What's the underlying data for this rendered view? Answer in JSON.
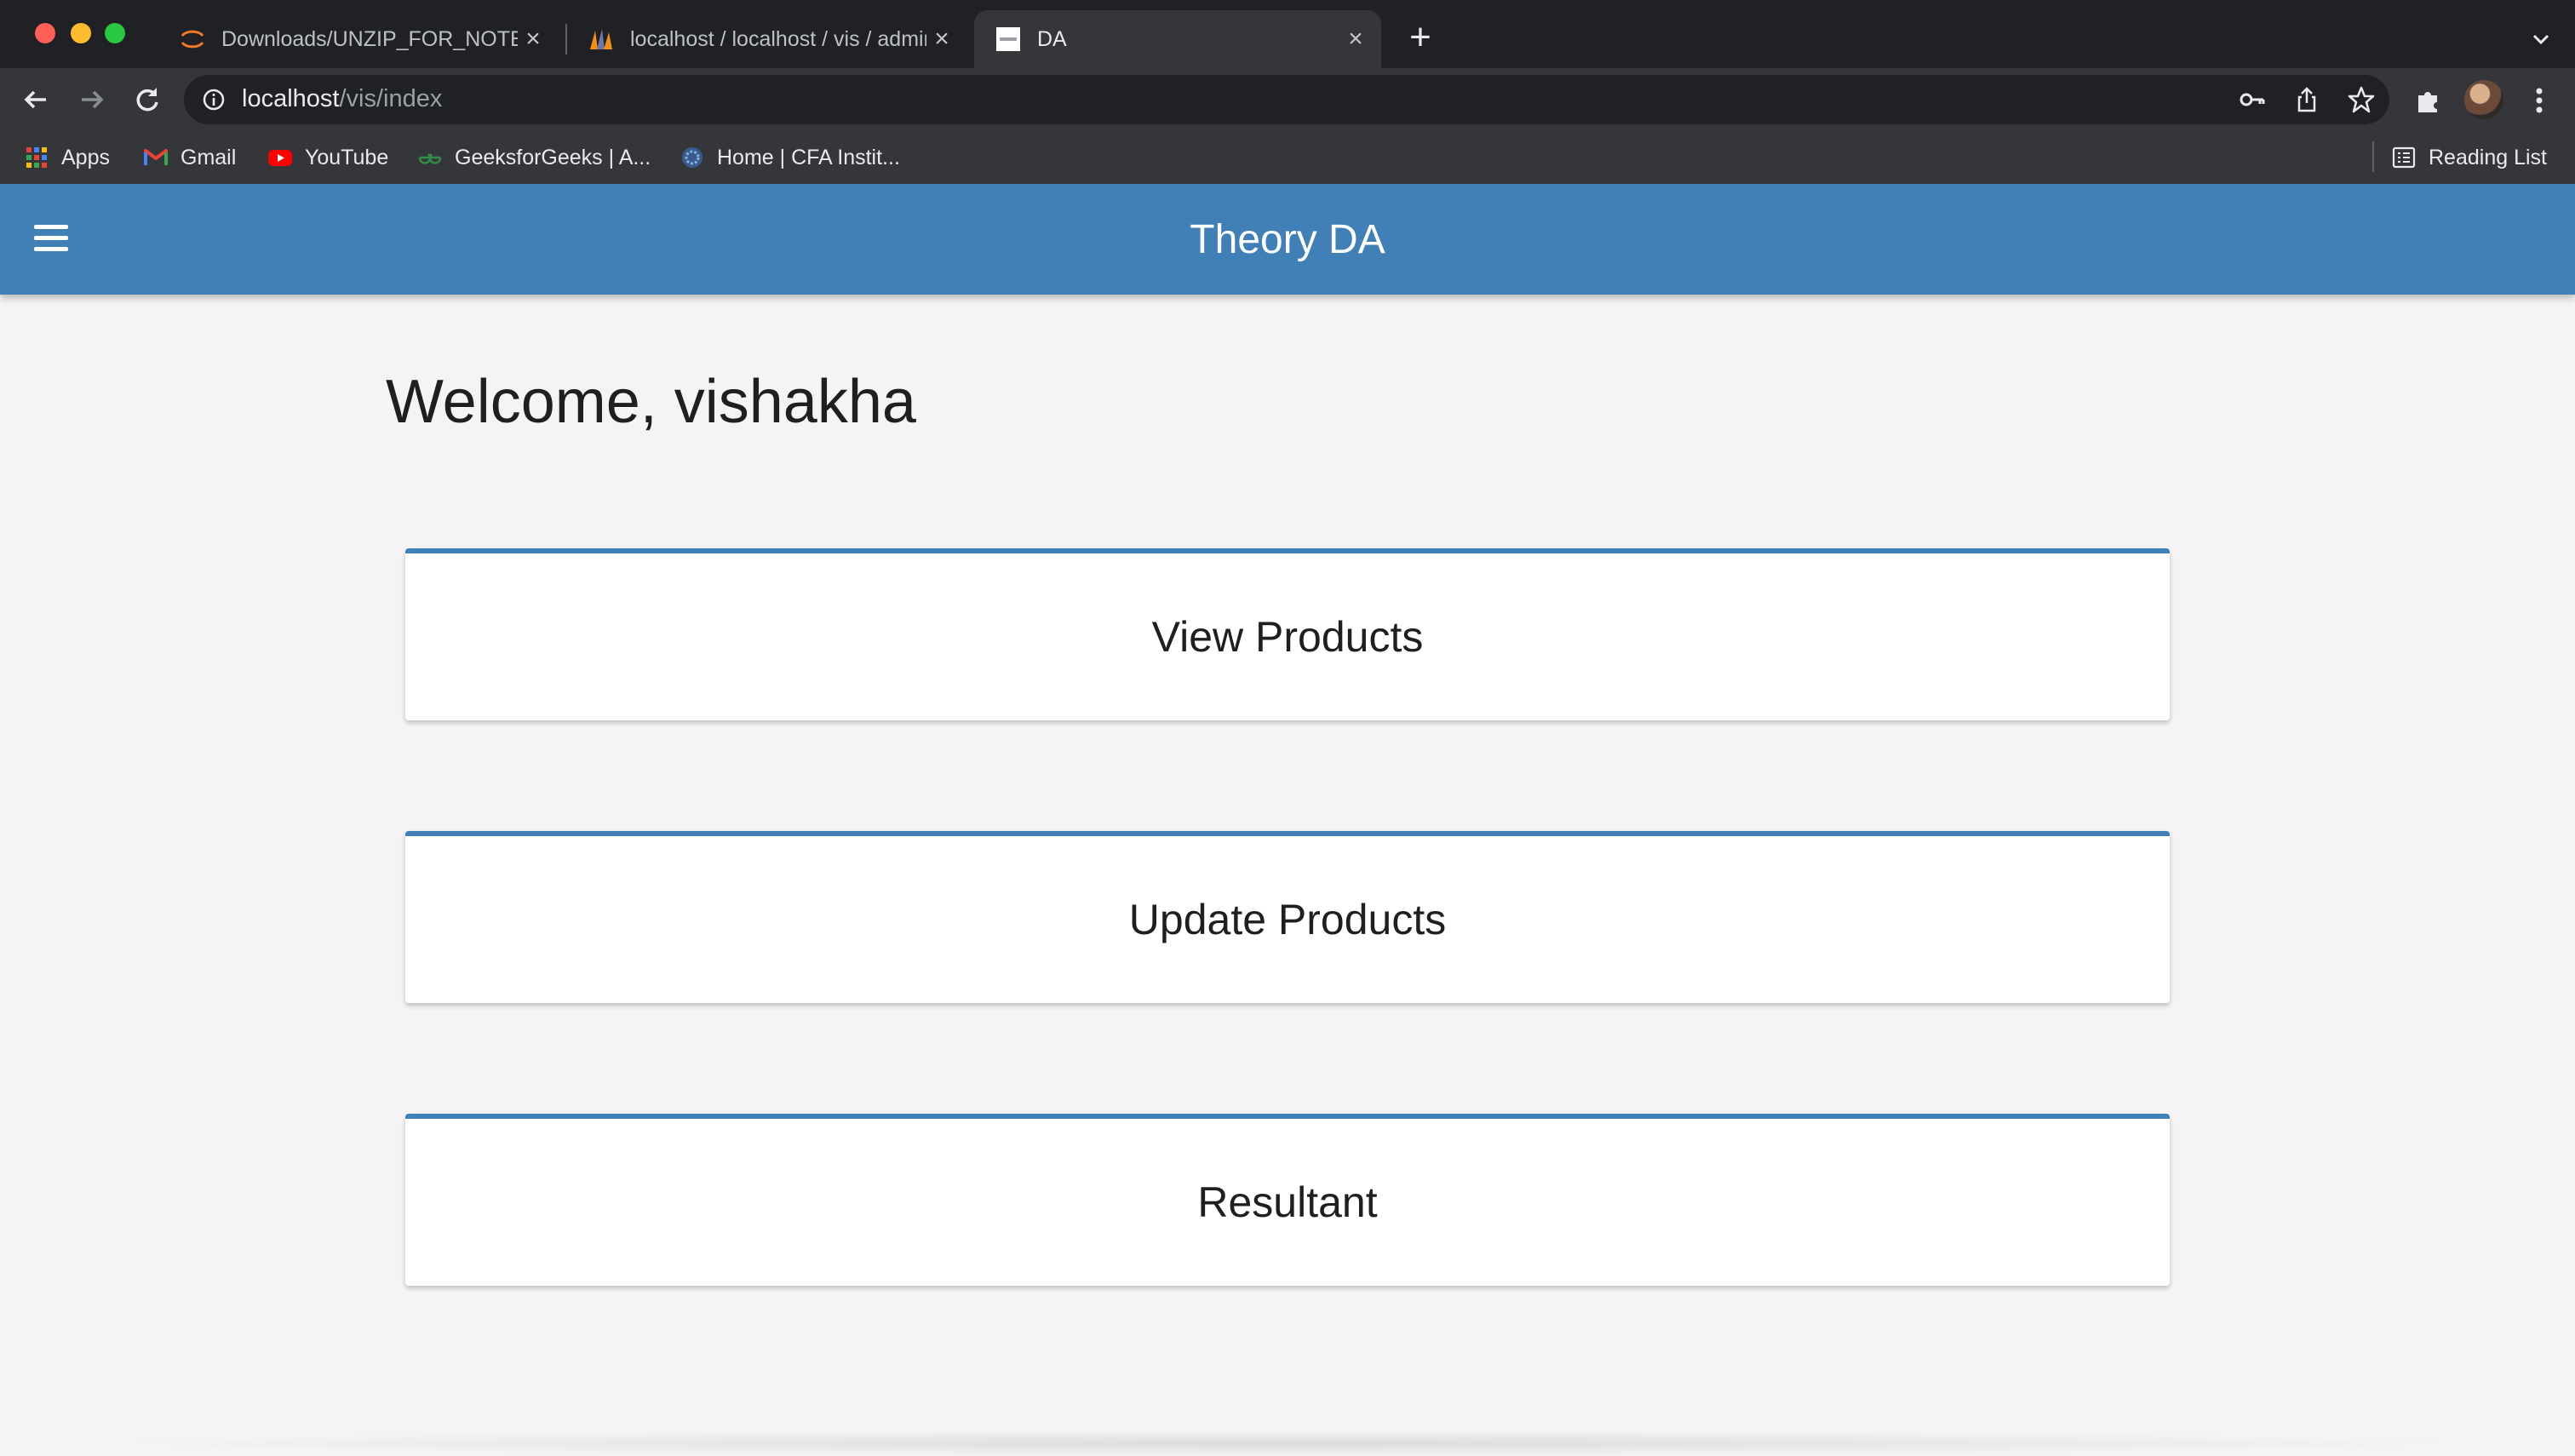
{
  "browser": {
    "tabs": [
      {
        "title": "Downloads/UNZIP_FOR_NOTEBOOKS",
        "favicon": "jupyter-icon",
        "active": false
      },
      {
        "title": "localhost / localhost / vis / admin",
        "favicon": "phpmyadmin-icon",
        "active": false
      },
      {
        "title": "DA",
        "favicon": "page-icon",
        "active": true
      }
    ],
    "address": {
      "host": "localhost",
      "path": "/vis/index"
    },
    "bookmarks": [
      {
        "label": "Apps",
        "icon": "apps-grid-icon"
      },
      {
        "label": "Gmail",
        "icon": "gmail-icon"
      },
      {
        "label": "YouTube",
        "icon": "youtube-icon"
      },
      {
        "label": "GeeksforGeeks | A...",
        "icon": "geeksforgeeks-icon"
      },
      {
        "label": "Home | CFA Instit...",
        "icon": "cfa-icon"
      }
    ],
    "reading_list": "Reading List"
  },
  "app": {
    "title": "Theory DA",
    "accent": "#4180b7",
    "welcome": "Welcome, vishakha",
    "cards": [
      {
        "label": "View Products"
      },
      {
        "label": "Update Products"
      },
      {
        "label": "Resultant"
      }
    ]
  }
}
